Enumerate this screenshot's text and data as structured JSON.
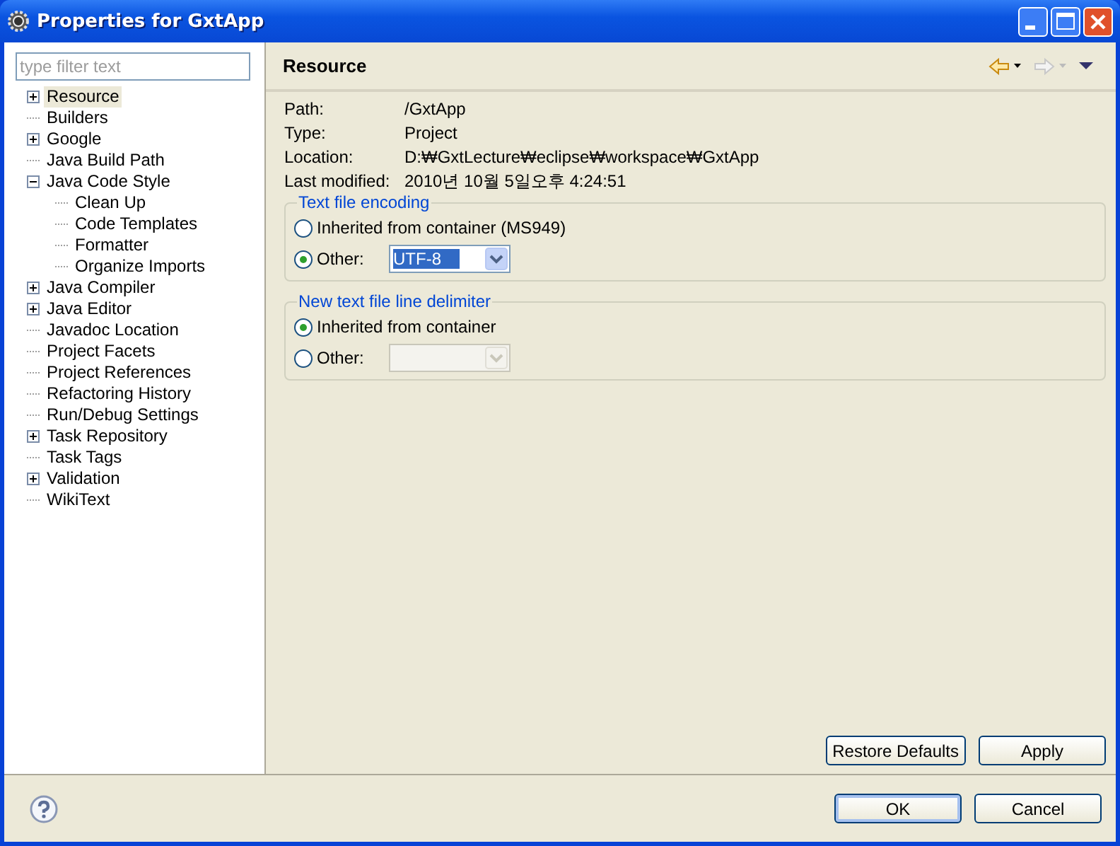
{
  "window": {
    "title": "Properties for GxtApp"
  },
  "filter": {
    "placeholder": "type filter text"
  },
  "tree": [
    {
      "label": "Resource",
      "selected": true,
      "expandable": true,
      "expanded": false
    },
    {
      "label": "Builders",
      "selected": false,
      "expandable": false
    },
    {
      "label": "Google",
      "selected": false,
      "expandable": true,
      "expanded": false
    },
    {
      "label": "Java Build Path",
      "selected": false,
      "expandable": false
    },
    {
      "label": "Java Code Style",
      "selected": false,
      "expandable": true,
      "expanded": true,
      "children": [
        {
          "label": "Clean Up",
          "selected": false,
          "expandable": false
        },
        {
          "label": "Code Templates",
          "selected": false,
          "expandable": false
        },
        {
          "label": "Formatter",
          "selected": false,
          "expandable": false
        },
        {
          "label": "Organize Imports",
          "selected": false,
          "expandable": false
        }
      ]
    },
    {
      "label": "Java Compiler",
      "selected": false,
      "expandable": true,
      "expanded": false
    },
    {
      "label": "Java Editor",
      "selected": false,
      "expandable": true,
      "expanded": false
    },
    {
      "label": "Javadoc Location",
      "selected": false,
      "expandable": false
    },
    {
      "label": "Project Facets",
      "selected": false,
      "expandable": false
    },
    {
      "label": "Project References",
      "selected": false,
      "expandable": false
    },
    {
      "label": "Refactoring History",
      "selected": false,
      "expandable": false
    },
    {
      "label": "Run/Debug Settings",
      "selected": false,
      "expandable": false
    },
    {
      "label": "Task Repository",
      "selected": false,
      "expandable": true,
      "expanded": false
    },
    {
      "label": "Task Tags",
      "selected": false,
      "expandable": false
    },
    {
      "label": "Validation",
      "selected": false,
      "expandable": true,
      "expanded": false
    },
    {
      "label": "WikiText",
      "selected": false,
      "expandable": false
    }
  ],
  "page": {
    "title": "Resource",
    "info": [
      {
        "label": "Path:",
        "value": "/GxtApp"
      },
      {
        "label": "Type:",
        "value": "Project"
      },
      {
        "label": "Location:",
        "value": "D:₩GxtLecture₩eclipse₩workspace₩GxtApp"
      },
      {
        "label": "Last modified:",
        "value": "2010년 10월 5일오후 4:24:51"
      }
    ],
    "groups": [
      {
        "title": "Text file encoding",
        "options": [
          {
            "label": "Inherited from container (MS949)",
            "selected": false
          },
          {
            "label": "Other:",
            "selected": true,
            "combo": {
              "value": "UTF-8",
              "disabled": false
            }
          }
        ]
      },
      {
        "title": "New text file line delimiter",
        "options": [
          {
            "label": "Inherited from container",
            "selected": true
          },
          {
            "label": "Other:",
            "selected": false,
            "combo": {
              "disabled": true
            }
          }
        ]
      }
    ],
    "buttons": [
      "Restore Defaults",
      "Apply"
    ]
  },
  "dialog_buttons": [
    {
      "label": "OK",
      "default": true
    },
    {
      "label": "Cancel",
      "default": false
    }
  ]
}
